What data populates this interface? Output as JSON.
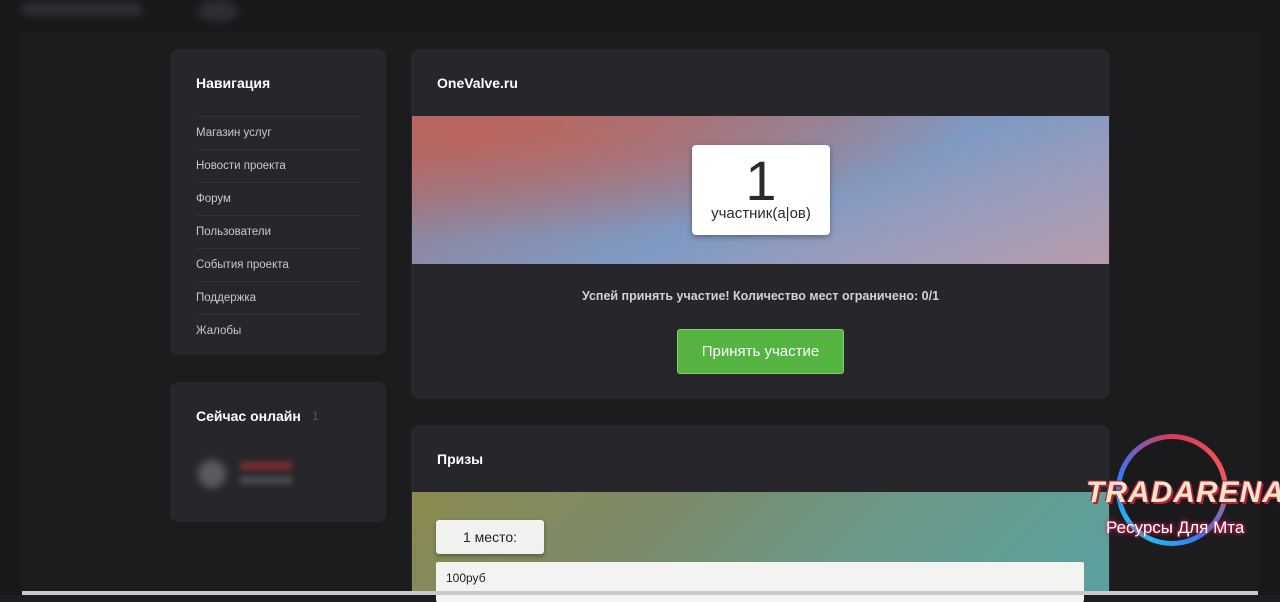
{
  "navigation": {
    "title": "Навигация",
    "items": [
      {
        "label": "Магазин услуг"
      },
      {
        "label": "Новости проекта"
      },
      {
        "label": "Форум"
      },
      {
        "label": "Пользователи"
      },
      {
        "label": "События проекта"
      },
      {
        "label": "Поддержка"
      },
      {
        "label": "Жалобы"
      }
    ]
  },
  "online": {
    "title": "Сейчас онлайн",
    "count": "1"
  },
  "event": {
    "title": "OneValve.ru",
    "participants_count": "1",
    "participants_label": "участник(а|ов)",
    "note": "Успей принять участие! Количество мест ограничено: 0/1",
    "join_button": "Принять участие"
  },
  "prizes": {
    "title": "Призы",
    "place_label": "1 место:",
    "prize_text": "100руб"
  },
  "watermark": {
    "title": "TRADARENA",
    "subtitle": "Ресурсы Для Мта"
  },
  "colors": {
    "background": "#1e1e22",
    "card": "#27272b",
    "accent_green": "#55b342"
  }
}
